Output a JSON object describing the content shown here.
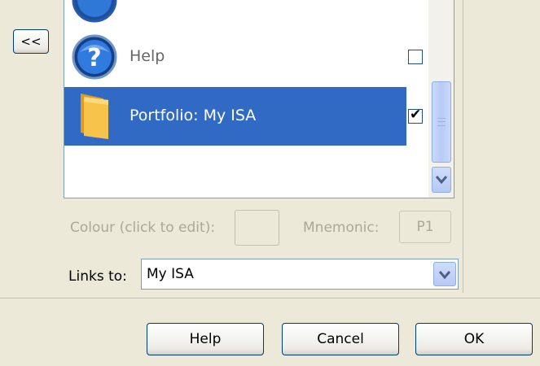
{
  "nav": {
    "collapse_label": "<<"
  },
  "list": {
    "items": [
      {
        "label": "Help",
        "icon": "help-icon",
        "checked": false,
        "selected": false
      },
      {
        "label": "Portfolio: My ISA",
        "icon": "folder-icon",
        "checked": true,
        "selected": true
      }
    ]
  },
  "properties": {
    "colour_label": "Colour (click to edit):",
    "mnemonic_label": "Mnemonic:",
    "mnemonic_value": "P1",
    "links_label": "Links to:",
    "links_value": "My ISA"
  },
  "buttons": {
    "help": "Help",
    "cancel": "Cancel",
    "ok": "OK"
  },
  "colors": {
    "selection": "#316ac5",
    "window": "#ece9d8",
    "button_border": "#003c74"
  }
}
